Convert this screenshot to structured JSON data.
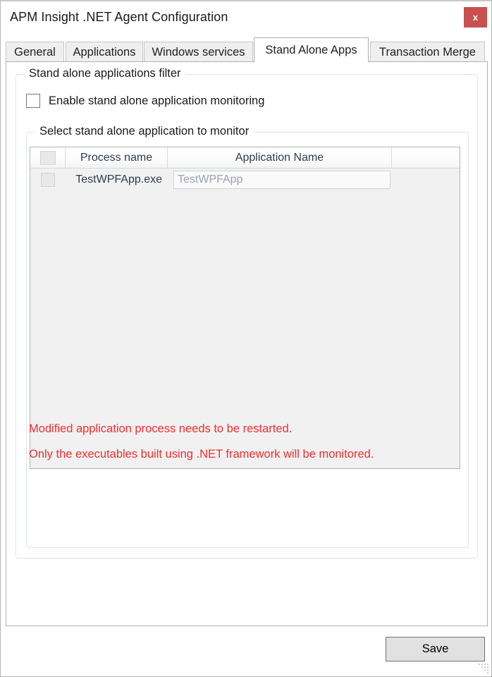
{
  "window": {
    "title": "APM Insight .NET Agent Configuration",
    "close_label": "x",
    "close_icon": "close-icon",
    "accent_close_color": "#c9504f"
  },
  "tabs": [
    {
      "label": "General",
      "active": false
    },
    {
      "label": "Applications",
      "active": false
    },
    {
      "label": "Windows services",
      "active": false
    },
    {
      "label": "Stand Alone Apps",
      "active": true
    },
    {
      "label": "Transaction Merge",
      "active": false
    }
  ],
  "outer_group": {
    "title": "Stand alone applications filter"
  },
  "enable_checkbox": {
    "label": "Enable stand alone application monitoring",
    "checked": false
  },
  "inner_group": {
    "title": "Select stand alone application to monitor"
  },
  "grid": {
    "columns": [
      "",
      "Process name",
      "Application Name",
      ""
    ],
    "rows": [
      {
        "selected": false,
        "process_name": "TestWPFApp.exe",
        "application_name": "TestWPFApp"
      }
    ]
  },
  "notes": {
    "line1": "Modified application process needs to be restarted.",
    "line2": "Only the executables built using .NET framework will be monitored.",
    "color": "#f22d2d"
  },
  "footer": {
    "save_label": "Save"
  }
}
